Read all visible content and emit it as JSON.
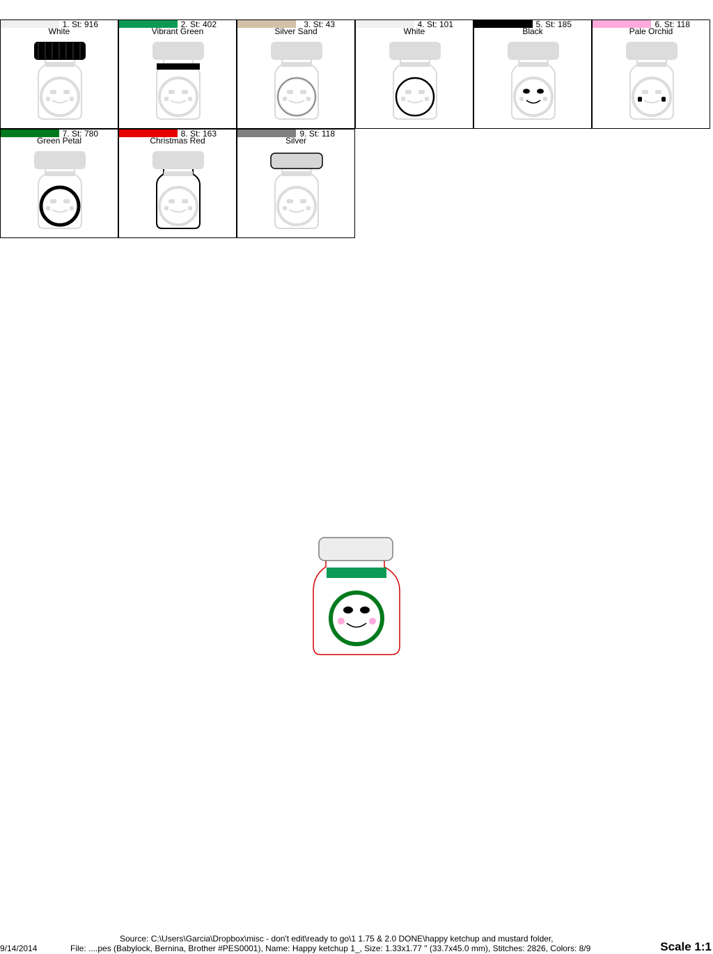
{
  "colors": [
    {
      "index": "1",
      "stitch": "1. St: 916",
      "name": "White",
      "hex": "#f0f0f0"
    },
    {
      "index": "2",
      "stitch": "2. St: 402",
      "name": "Vibrant Green",
      "hex": "#0e9a55"
    },
    {
      "index": "3",
      "stitch": "3. St: 43",
      "name": "Silver Sand",
      "hex": "#d3c0a6"
    },
    {
      "index": "4",
      "stitch": "4. St: 101",
      "name": "White",
      "hex": "#f0f0f0"
    },
    {
      "index": "5",
      "stitch": "5. St: 185",
      "name": "Black",
      "hex": "#000000"
    },
    {
      "index": "6",
      "stitch": "6. St: 118",
      "name": "Pale Orchid",
      "hex": "#ffaadd"
    },
    {
      "index": "7",
      "stitch": "7. St: 780",
      "name": "Green Petal",
      "hex": "#007a1c"
    },
    {
      "index": "8",
      "stitch": "8. St: 163",
      "name": "Christmas Red",
      "hex": "#e60000"
    },
    {
      "index": "9",
      "stitch": "9. St: 118",
      "name": "Silver",
      "hex": "#808080"
    }
  ],
  "footer": {
    "date": "9/14/2014",
    "source_line": "Source: C:\\Users\\Garcia\\Dropbox\\misc - don't edit\\ready to go\\1 1.75 & 2.0 DONE\\happy ketchup and mustard folder,",
    "file_line": "File: ....pes (Babylock, Bernina, Brother #PES0001), Name: Happy ketchup 1_, Size: 1.33x1.77 \" (33.7x45.0 mm), Stitches: 2826, Colors: 8/9",
    "scale": "Scale 1:1"
  }
}
